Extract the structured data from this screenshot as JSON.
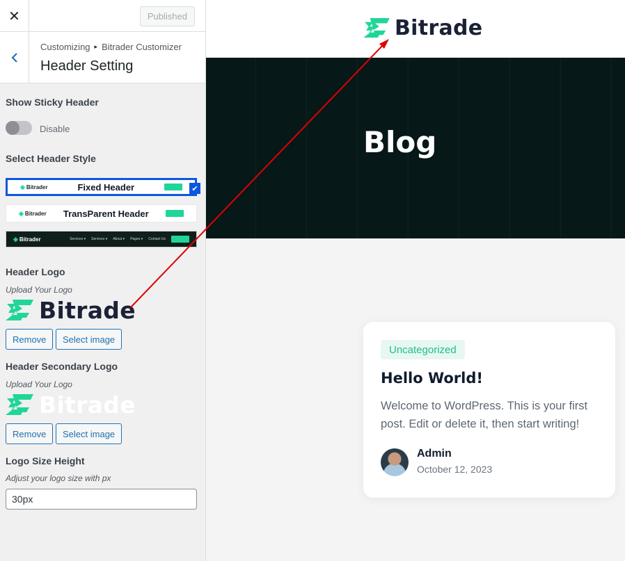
{
  "topbar": {
    "close_icon": "close-icon",
    "published_label": "Published"
  },
  "section": {
    "back_icon": "chevron-left-icon",
    "breadcrumb_root": "Customizing",
    "breadcrumb_parent": "Bitrader Customizer",
    "title": "Header Setting"
  },
  "sticky": {
    "label": "Show Sticky Header",
    "state_text": "Disable",
    "enabled": false
  },
  "header_style": {
    "label": "Select Header Style",
    "options": [
      {
        "title": "Fixed Header",
        "logo": "Bitrader",
        "selected": true
      },
      {
        "title": "TransParent Header",
        "logo": "Bitrader",
        "selected": false
      },
      {
        "title": "",
        "logo": "Bitrader",
        "nav": [
          "Services ▾",
          "Services ▾",
          "About ▾",
          "Pages ▾",
          "Contact Us"
        ],
        "selected": false
      }
    ]
  },
  "header_logo": {
    "label": "Header Logo",
    "desc": "Upload Your Logo",
    "logo_text": "Bitrade",
    "remove_label": "Remove",
    "select_label": "Select image"
  },
  "secondary_logo": {
    "label": "Header Secondary Logo",
    "desc": "Upload Your Logo",
    "logo_text": "Bitrade",
    "remove_label": "Remove",
    "select_label": "Select image"
  },
  "logo_size": {
    "label": "Logo Size Height",
    "desc": "Adjust your logo size with px",
    "value": "30px"
  },
  "preview": {
    "site_logo_text": "Bitrade",
    "hero_title": "Blog",
    "post": {
      "category": "Uncategorized",
      "title": "Hello World!",
      "excerpt": "Welcome to WordPress. This is your first post. Edit or delete it, then start writing!",
      "author": "Admin",
      "date": "October 12, 2023"
    }
  },
  "colors": {
    "brand_green": "#1fd698",
    "selection_blue": "#0d56e0",
    "wp_blue": "#2271b1",
    "arrow_red": "#e00000"
  }
}
